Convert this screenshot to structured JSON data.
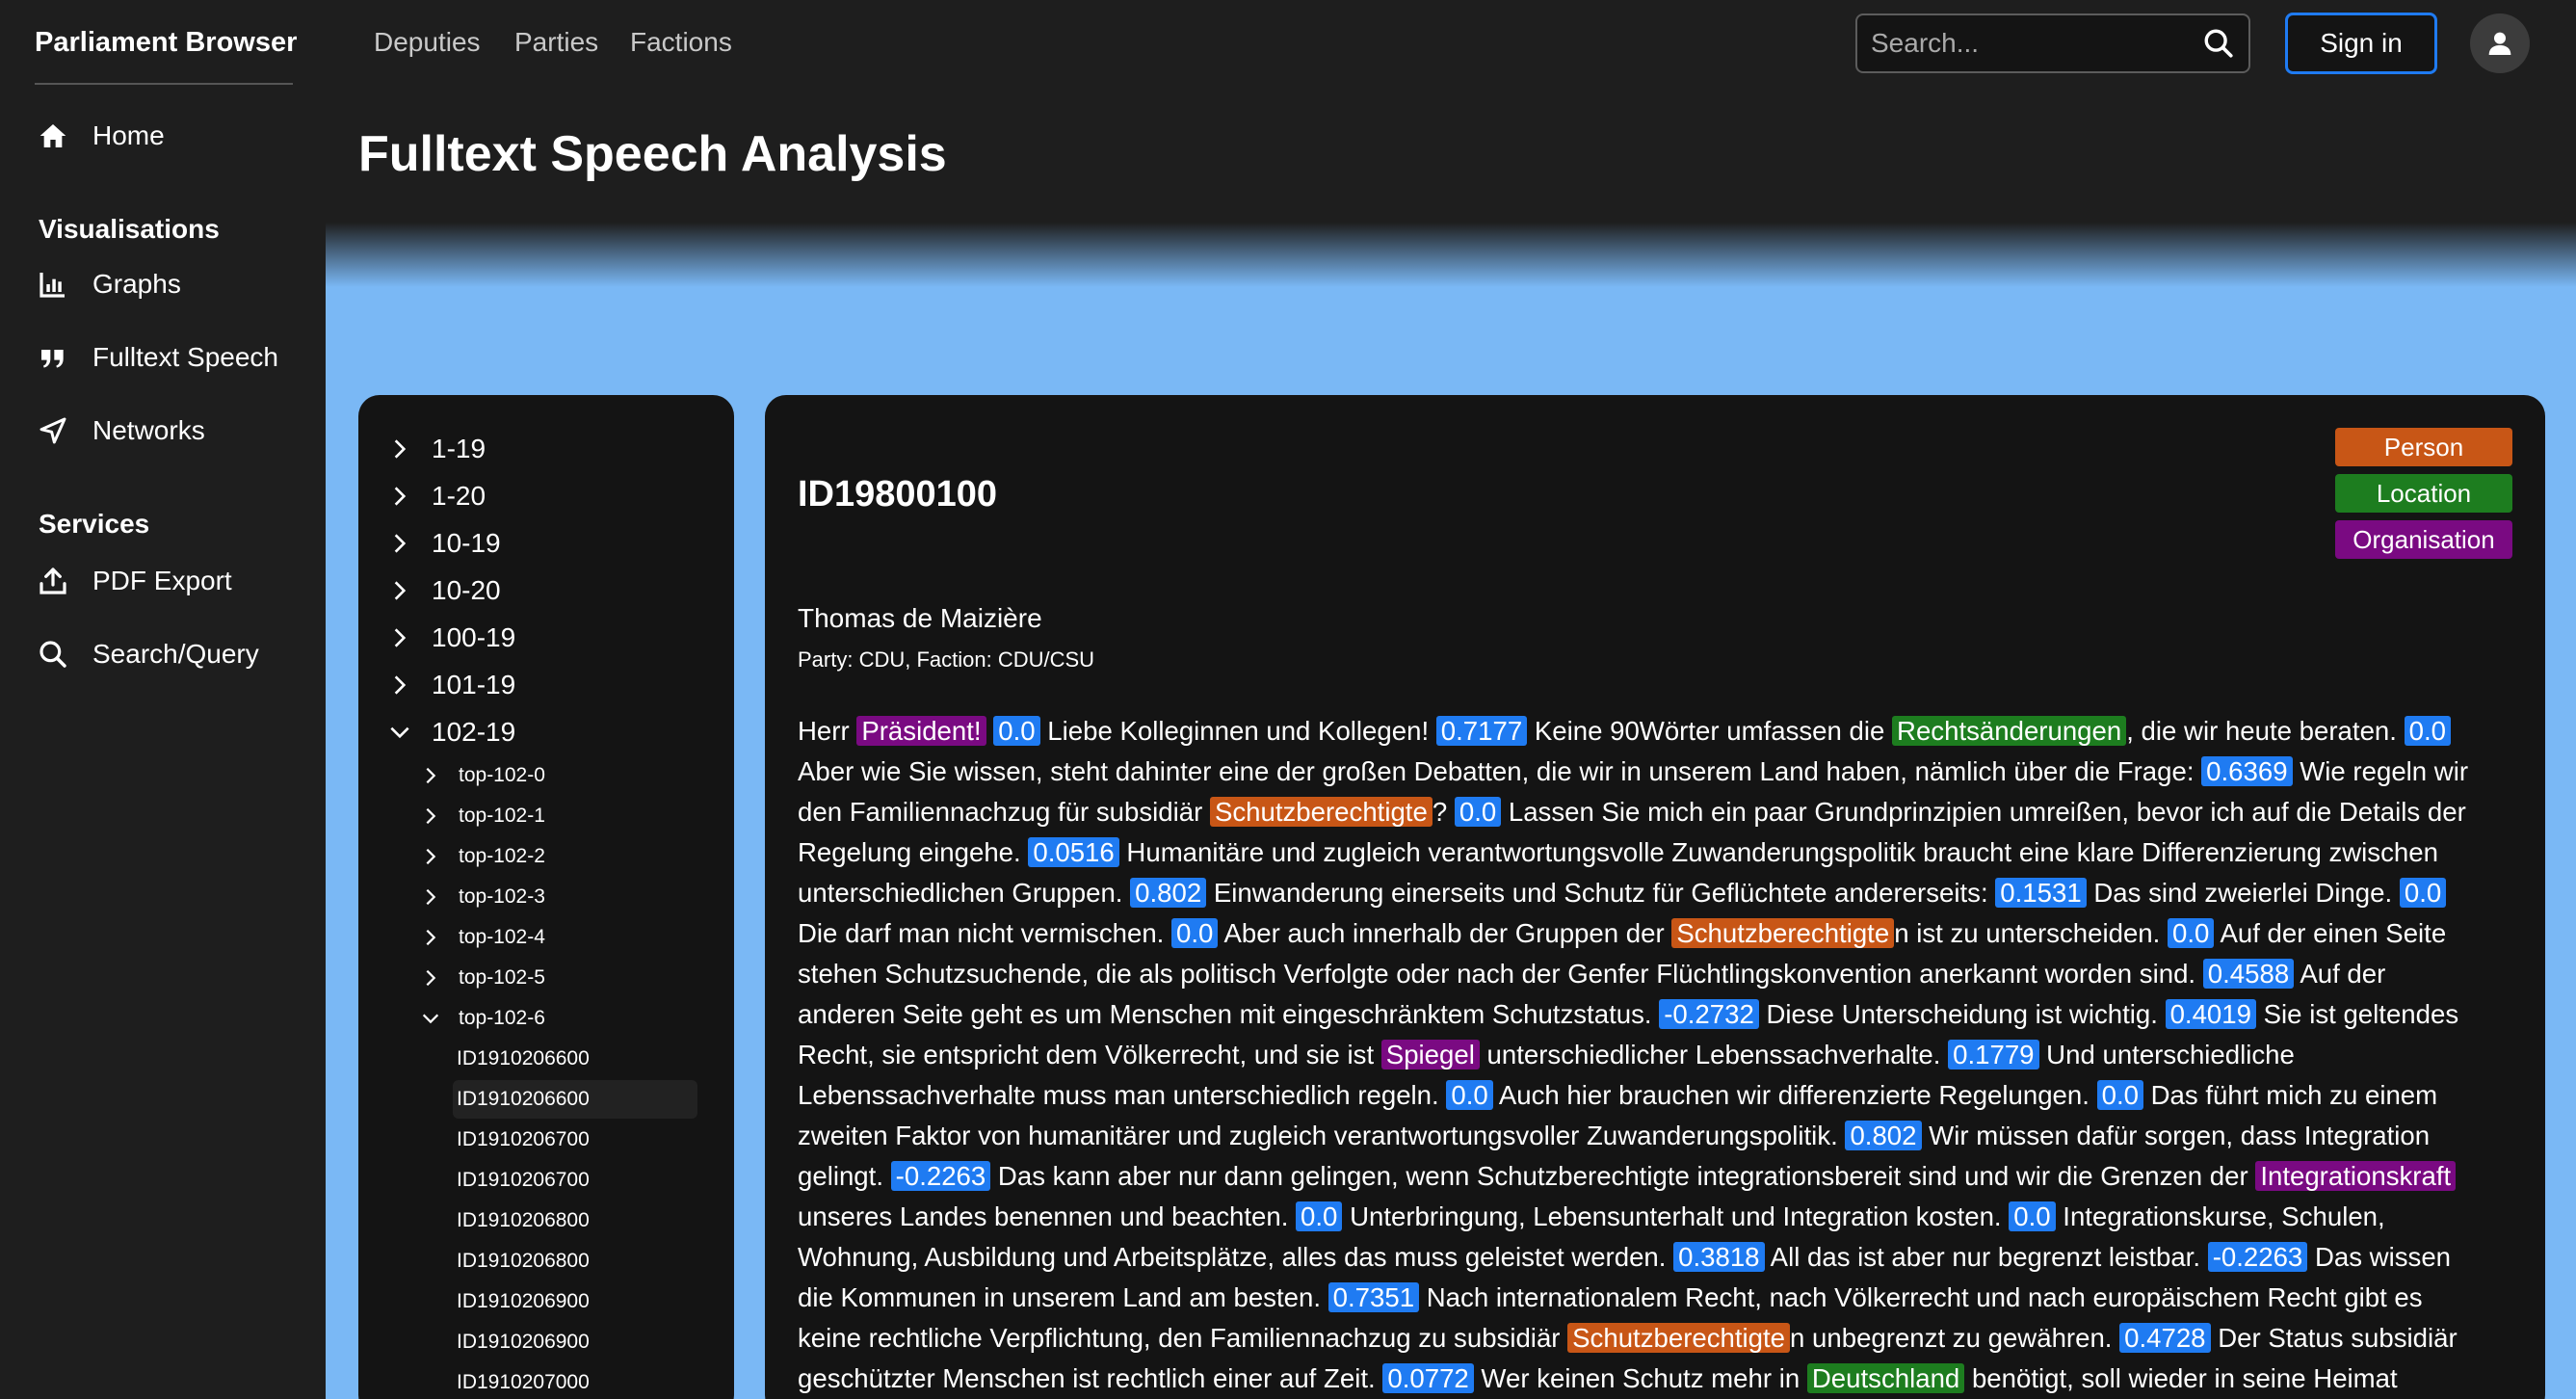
{
  "app": {
    "brand": "Parliament Browser"
  },
  "sidebar": {
    "home": "Home",
    "section_vis": "Visualisations",
    "graphs": "Graphs",
    "fulltext": "Fulltext Speech",
    "networks": "Networks",
    "section_services": "Services",
    "pdf": "PDF Export",
    "search": "Search/Query"
  },
  "topnav": {
    "links": [
      "Deputies",
      "Parties",
      "Factions"
    ],
    "search_placeholder": "Search...",
    "signin": "Sign in"
  },
  "page": {
    "title": "Fulltext Speech Analysis"
  },
  "tree": {
    "top": [
      "1-19",
      "1-20",
      "10-19",
      "10-20",
      "100-19",
      "101-19",
      "102-19"
    ],
    "tops": [
      "top-102-0",
      "top-102-1",
      "top-102-2",
      "top-102-3",
      "top-102-4",
      "top-102-5",
      "top-102-6"
    ],
    "ids": [
      "ID1910206600",
      "ID1910206600",
      "ID1910206700",
      "ID1910206700",
      "ID1910206800",
      "ID1910206800",
      "ID1910206900",
      "ID1910206900",
      "ID1910207000"
    ]
  },
  "speech": {
    "id": "ID19800100",
    "speaker": "Thomas de Maizière",
    "party_line": "Party: CDU, Faction: CDU/CSU",
    "legend": {
      "person": "Person",
      "location": "Location",
      "organisation": "Organisation"
    },
    "lines": [
      [
        [
          "t",
          "Herr "
        ],
        [
          "o",
          "Präsident!"
        ],
        [
          "t",
          " "
        ],
        [
          "s",
          "0.0"
        ],
        [
          "t",
          " Liebe Kolleginnen und Kollegen! "
        ],
        [
          "s",
          "0.7177"
        ],
        [
          "t",
          " Keine 90Wörter umfassen die "
        ],
        [
          "l",
          "Rechtsänderungen"
        ],
        [
          "t",
          ", die wir heute beraten. "
        ],
        [
          "s",
          "0.0"
        ]
      ],
      [
        [
          "t",
          "Aber wie Sie wissen, steht dahinter eine der großen Debatten, die wir in unserem Land haben, nämlich über die Frage: "
        ],
        [
          "s",
          "0.6369"
        ],
        [
          "t",
          " Wie regeln wir"
        ]
      ],
      [
        [
          "t",
          "den Familiennachzug für subsidiär "
        ],
        [
          "p",
          "Schutzberechtigte"
        ],
        [
          "t",
          "? "
        ],
        [
          "s",
          "0.0"
        ],
        [
          "t",
          " Lassen Sie mich ein paar Grundprinzipien umreißen, bevor ich auf die Details der"
        ]
      ],
      [
        [
          "t",
          "Regelung eingehe. "
        ],
        [
          "s",
          "0.0516"
        ],
        [
          "t",
          " Humanitäre und zugleich verantwortungsvolle Zuwanderungspolitik braucht eine klare Differenzierung zwischen"
        ]
      ],
      [
        [
          "t",
          "unterschiedlichen Gruppen. "
        ],
        [
          "s",
          "0.802"
        ],
        [
          "t",
          " Einwanderung einerseits und Schutz für Geflüchtete andererseits: "
        ],
        [
          "s",
          "0.1531"
        ],
        [
          "t",
          " Das sind zweierlei Dinge. "
        ],
        [
          "s",
          "0.0"
        ]
      ],
      [
        [
          "t",
          "Die darf man nicht vermischen. "
        ],
        [
          "s",
          "0.0"
        ],
        [
          "t",
          " Aber auch innerhalb der Gruppen der "
        ],
        [
          "p",
          "Schutzberechtigte"
        ],
        [
          "t",
          "n ist zu unterscheiden. "
        ],
        [
          "s",
          "0.0"
        ],
        [
          "t",
          " Auf der einen Seite"
        ]
      ],
      [
        [
          "t",
          "stehen Schutzsuchende, die als politisch Verfolgte oder nach der Genfer Flüchtlingskonvention anerkannt worden sind. "
        ],
        [
          "s",
          "0.4588"
        ],
        [
          "t",
          " Auf der"
        ]
      ],
      [
        [
          "t",
          "anderen Seite geht es um Menschen mit eingeschränktem Schutzstatus. "
        ],
        [
          "s",
          "-0.2732"
        ],
        [
          "t",
          " Diese Unterscheidung ist wichtig. "
        ],
        [
          "s",
          "0.4019"
        ],
        [
          "t",
          " Sie ist geltendes"
        ]
      ],
      [
        [
          "t",
          "Recht, sie entspricht dem Völkerrecht, und sie ist "
        ],
        [
          "o",
          "Spiegel"
        ],
        [
          "t",
          " unterschiedlicher Lebenssachverhalte. "
        ],
        [
          "s",
          "0.1779"
        ],
        [
          "t",
          " Und unterschiedliche"
        ]
      ],
      [
        [
          "t",
          "Lebenssachverhalte muss man unterschiedlich regeln. "
        ],
        [
          "s",
          "0.0"
        ],
        [
          "t",
          " Auch hier brauchen wir differenzierte Regelungen. "
        ],
        [
          "s",
          "0.0"
        ],
        [
          "t",
          " Das führt mich zu einem"
        ]
      ],
      [
        [
          "t",
          "zweiten Faktor von humanitärer und zugleich verantwortungsvoller Zuwanderungspolitik. "
        ],
        [
          "s",
          "0.802"
        ],
        [
          "t",
          " Wir müssen dafür sorgen, dass Integration"
        ]
      ],
      [
        [
          "t",
          "gelingt. "
        ],
        [
          "s",
          "-0.2263"
        ],
        [
          "t",
          " Das kann aber nur dann gelingen, wenn Schutzberechtigte integrationsbereit sind und wir die Grenzen der "
        ],
        [
          "o",
          "Integrationskraft"
        ]
      ],
      [
        [
          "t",
          "unseres Landes benennen und beachten. "
        ],
        [
          "s",
          "0.0"
        ],
        [
          "t",
          " Unterbringung, Lebensunterhalt und Integration kosten. "
        ],
        [
          "s",
          "0.0"
        ],
        [
          "t",
          " Integrationskurse, Schulen,"
        ]
      ],
      [
        [
          "t",
          "Wohnung, Ausbildung und Arbeitsplätze, alles das muss geleistet werden. "
        ],
        [
          "s",
          "0.3818"
        ],
        [
          "t",
          " All das ist aber nur begrenzt leistbar. "
        ],
        [
          "s",
          "-0.2263"
        ],
        [
          "t",
          " Das wissen"
        ]
      ],
      [
        [
          "t",
          "die Kommunen in unserem Land am besten. "
        ],
        [
          "s",
          "0.7351"
        ],
        [
          "t",
          " Nach internationalem Recht, nach Völkerrecht und nach europäischem Recht gibt es"
        ]
      ],
      [
        [
          "t",
          "keine rechtliche Verpflichtung, den Familiennachzug zu subsidiär "
        ],
        [
          "p",
          "Schutzberechtigte"
        ],
        [
          "t",
          "n unbegrenzt zu gewähren. "
        ],
        [
          "s",
          "0.4728"
        ],
        [
          "t",
          " Der Status subsidiär"
        ]
      ],
      [
        [
          "t",
          "geschützter Menschen ist rechtlich einer auf Zeit. "
        ],
        [
          "s",
          "0.0772"
        ],
        [
          "t",
          " Wer keinen Schutz mehr in "
        ],
        [
          "l",
          "Deutschland"
        ],
        [
          "t",
          " benötigt, soll wieder in seine Heimat"
        ]
      ]
    ]
  }
}
